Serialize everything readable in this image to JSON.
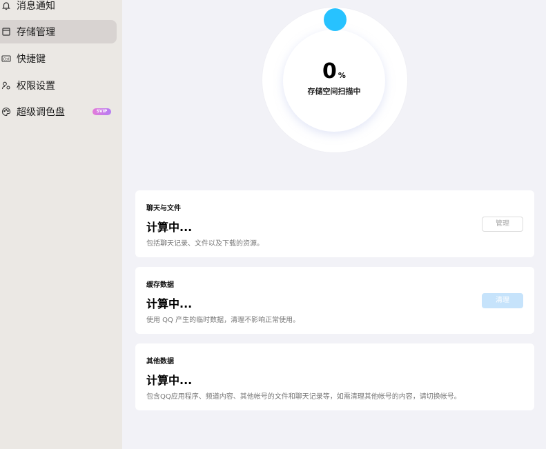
{
  "sidebar": {
    "items": [
      {
        "label": "消息通知",
        "icon": "bell-icon"
      },
      {
        "label": "存储管理",
        "icon": "storage-icon",
        "active": true
      },
      {
        "label": "快捷键",
        "icon": "keyboard-icon"
      },
      {
        "label": "权限设置",
        "icon": "permission-icon"
      },
      {
        "label": "超级调色盘",
        "icon": "palette-icon",
        "badge": "SVIP"
      }
    ]
  },
  "progress": {
    "value": 0,
    "value_text": "0",
    "unit": "%",
    "label": "存储空间扫描中"
  },
  "cards": [
    {
      "title": "聊天与文件",
      "value": "计算中...",
      "desc": "包括聊天记录、文件以及下载的资源。",
      "button": "管理"
    },
    {
      "title": "缓存数据",
      "value": "计算中...",
      "desc": "使用 QQ 产生的临时数据，清理不影响正常使用。",
      "button": "清理"
    },
    {
      "title": "其他数据",
      "value": "计算中...",
      "desc": "包含QQ应用程序、频道内容、其他帐号的文件和聊天记录等，如需清理其他帐号的内容，请切换帐号。"
    }
  ],
  "colors": {
    "accent": "#27c2ff",
    "sidebar_bg": "#ebe8e4",
    "main_bg": "#f2f2f7",
    "active_item_bg": "#d8d3d1",
    "disabled_button": "#c6e3fb"
  }
}
